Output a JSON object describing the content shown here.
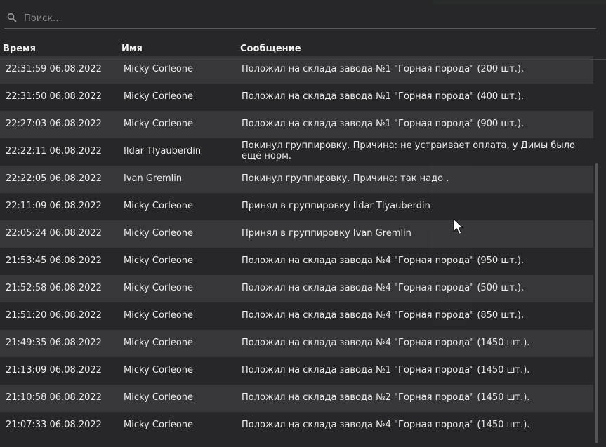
{
  "search": {
    "placeholder": "Поиск..."
  },
  "columns": {
    "time": "Время",
    "name": "Имя",
    "message": "Сообщение"
  },
  "rows": [
    {
      "time": "22:31:59 06.08.2022",
      "name": "Micky Corleone",
      "message": "Положил на склада завода №1 \"Горная порода\" (200 шт.)."
    },
    {
      "time": "22:31:50 06.08.2022",
      "name": "Micky Corleone",
      "message": "Положил на склада завода №1 \"Горная порода\" (400 шт.)."
    },
    {
      "time": "22:27:03 06.08.2022",
      "name": "Micky Corleone",
      "message": "Положил на склада завода №1 \"Горная порода\" (900 шт.)."
    },
    {
      "time": "22:22:11 06.08.2022",
      "name": "Ildar Tlyauberdin",
      "message": "Покинул группировку. Причина: не устраивает оплата, у Димы было ещё норм."
    },
    {
      "time": "22:22:05 06.08.2022",
      "name": "Ivan Gremlin",
      "message": "Покинул группировку. Причина: так надо ."
    },
    {
      "time": "22:11:09 06.08.2022",
      "name": "Micky Corleone",
      "message": "Принял в группировку Ildar Tlyauberdin"
    },
    {
      "time": "22:05:24 06.08.2022",
      "name": "Micky Corleone",
      "message": "Принял в группировку Ivan Gremlin"
    },
    {
      "time": "21:53:45 06.08.2022",
      "name": "Micky Corleone",
      "message": "Положил на склада завода №4 \"Горная порода\" (950 шт.)."
    },
    {
      "time": "21:52:58 06.08.2022",
      "name": "Micky Corleone",
      "message": "Положил на склада завода №4 \"Горная порода\" (500 шт.)."
    },
    {
      "time": "21:51:20 06.08.2022",
      "name": "Micky Corleone",
      "message": "Положил на склада завода №4 \"Горная порода\" (850 шт.)."
    },
    {
      "time": "21:49:35 06.08.2022",
      "name": "Micky Corleone",
      "message": "Положил на склада завода №4 \"Горная порода\" (1450 шт.)."
    },
    {
      "time": "21:13:09 06.08.2022",
      "name": "Micky Corleone",
      "message": "Положил на склада завода №1 \"Горная порода\" (1450 шт.)."
    },
    {
      "time": "21:10:58 06.08.2022",
      "name": "Micky Corleone",
      "message": "Положил на склада завода №2 \"Горная порода\" (1450 шт.)."
    },
    {
      "time": "21:07:33 06.08.2022",
      "name": "Micky Corleone",
      "message": "Положил на склада завода №4 \"Горная порода\" (1450 шт.)."
    }
  ],
  "colors": {
    "accent_green": "#25723a",
    "row_alt": "#464649",
    "text": "#ececec"
  },
  "icons": {
    "search": "search-icon",
    "cursor": "mouse-cursor-icon"
  }
}
